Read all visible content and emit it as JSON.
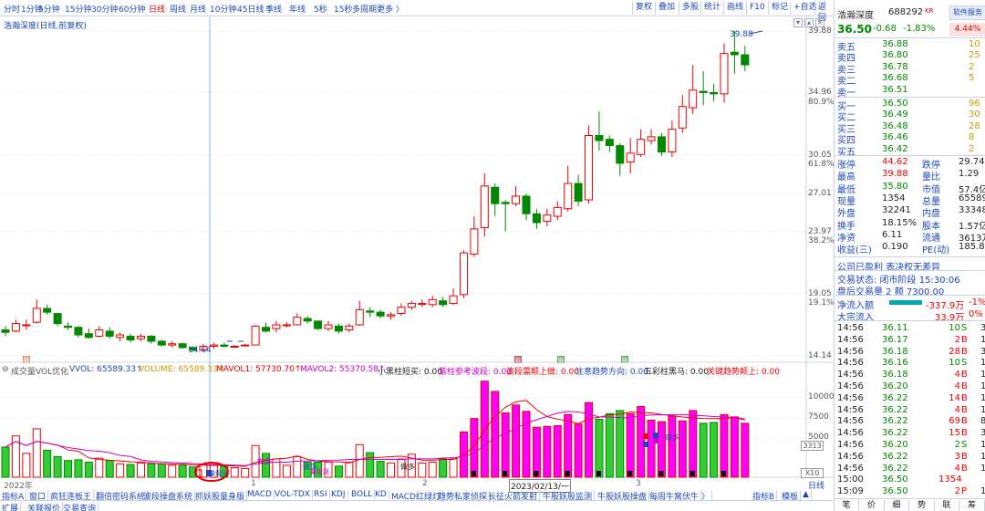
{
  "toolbar": {
    "periods": [
      "分时",
      "1分钟",
      "5分钟",
      "15分钟",
      "30分钟",
      "60分钟",
      "日线",
      "周线",
      "月线",
      "10分钟",
      "45日线",
      "季线",
      "年线",
      "5秒",
      "15秒",
      "多周期",
      "更多 〉"
    ],
    "active": "日线",
    "right": [
      "复权",
      "叠加",
      "多股",
      "统计",
      "画线",
      "F10",
      "标记",
      "+自选",
      "返回"
    ]
  },
  "chart_title": "浩瀚深度(日线,前复权)",
  "price_axis": [
    "39.88",
    "34.96",
    "30.05",
    "27.01",
    "23.97",
    "19.05",
    "14.14"
  ],
  "pct_axis": [
    "80.9%",
    "61.8%",
    "38.2%",
    "19.1%"
  ],
  "price_marks": {
    "high": "39.88",
    "low": "14.64"
  },
  "markers": [
    "融",
    "融",
    "融",
    "融"
  ],
  "candles": [
    {
      "o": 16.2,
      "c": 16.0,
      "h": 16.5,
      "l": 15.7
    },
    {
      "o": 16.1,
      "c": 16.7,
      "h": 17.0,
      "l": 16.0
    },
    {
      "o": 16.6,
      "c": 16.6,
      "h": 17.0,
      "l": 16.2
    },
    {
      "o": 16.8,
      "c": 17.9,
      "h": 18.6,
      "l": 16.7
    },
    {
      "o": 17.9,
      "c": 17.6,
      "h": 18.2,
      "l": 17.4
    },
    {
      "o": 17.5,
      "c": 16.7,
      "h": 17.5,
      "l": 16.5
    },
    {
      "o": 16.5,
      "c": 16.4,
      "h": 16.8,
      "l": 16.2
    },
    {
      "o": 16.4,
      "c": 15.8,
      "h": 16.5,
      "l": 15.6
    },
    {
      "o": 15.9,
      "c": 15.6,
      "h": 16.3,
      "l": 15.5
    },
    {
      "o": 15.7,
      "c": 16.2,
      "h": 16.5,
      "l": 15.6
    },
    {
      "o": 16.1,
      "c": 15.7,
      "h": 16.4,
      "l": 15.5
    },
    {
      "o": 15.6,
      "c": 15.8,
      "h": 16.0,
      "l": 15.3
    },
    {
      "o": 15.7,
      "c": 15.4,
      "h": 15.9,
      "l": 15.2
    },
    {
      "o": 15.5,
      "c": 15.7,
      "h": 15.9,
      "l": 15.3
    },
    {
      "o": 15.7,
      "c": 15.3,
      "h": 15.8,
      "l": 15.1
    },
    {
      "o": 15.3,
      "c": 15.0,
      "h": 15.4,
      "l": 14.9
    },
    {
      "o": 15.0,
      "c": 15.1,
      "h": 15.3,
      "l": 14.8
    },
    {
      "o": 15.1,
      "c": 14.8,
      "h": 15.2,
      "l": 14.7
    },
    {
      "o": 14.8,
      "c": 14.6,
      "h": 14.9,
      "l": 14.5
    },
    {
      "o": 14.6,
      "c": 14.9,
      "h": 15.1,
      "l": 14.5
    },
    {
      "o": 14.9,
      "c": 15.0,
      "h": 15.2,
      "l": 14.7
    },
    {
      "o": 15.0,
      "c": 14.9,
      "h": 15.2,
      "l": 14.8
    },
    {
      "o": 14.9,
      "c": 14.9,
      "h": 15.0,
      "l": 14.8
    },
    {
      "o": 15.0,
      "c": 15.0,
      "h": 15.1,
      "l": 14.9
    },
    {
      "o": 15.0,
      "c": 16.5,
      "h": 16.6,
      "l": 15.0
    },
    {
      "o": 16.4,
      "c": 16.1,
      "h": 16.8,
      "l": 16.0
    },
    {
      "o": 16.3,
      "c": 16.6,
      "h": 16.9,
      "l": 16.0
    },
    {
      "o": 16.6,
      "c": 16.6,
      "h": 16.8,
      "l": 16.4
    },
    {
      "o": 16.6,
      "c": 17.2,
      "h": 17.5,
      "l": 16.6
    },
    {
      "o": 17.1,
      "c": 16.9,
      "h": 17.3,
      "l": 16.7
    },
    {
      "o": 16.9,
      "c": 16.3,
      "h": 16.9,
      "l": 16.2
    },
    {
      "o": 16.3,
      "c": 16.6,
      "h": 16.9,
      "l": 16.1
    },
    {
      "o": 16.5,
      "c": 16.1,
      "h": 16.7,
      "l": 15.9
    },
    {
      "o": 16.2,
      "c": 16.5,
      "h": 16.7,
      "l": 16.0
    },
    {
      "o": 16.6,
      "c": 17.8,
      "h": 18.5,
      "l": 16.5
    },
    {
      "o": 17.7,
      "c": 17.6,
      "h": 18.0,
      "l": 17.2
    },
    {
      "o": 17.6,
      "c": 17.3,
      "h": 17.8,
      "l": 17.1
    },
    {
      "o": 17.3,
      "c": 17.4,
      "h": 17.6,
      "l": 17.0
    },
    {
      "o": 17.5,
      "c": 18.0,
      "h": 18.3,
      "l": 17.3
    },
    {
      "o": 18.0,
      "c": 18.3,
      "h": 18.5,
      "l": 17.8
    },
    {
      "o": 18.3,
      "c": 18.3,
      "h": 18.6,
      "l": 18.0
    },
    {
      "o": 18.2,
      "c": 18.6,
      "h": 18.9,
      "l": 18.0
    },
    {
      "o": 18.5,
      "c": 18.2,
      "h": 18.8,
      "l": 18.0
    },
    {
      "o": 18.3,
      "c": 18.9,
      "h": 19.5,
      "l": 18.2
    },
    {
      "o": 19.0,
      "c": 22.3,
      "h": 22.5,
      "l": 18.7
    },
    {
      "o": 22.2,
      "c": 24.2,
      "h": 25.2,
      "l": 22.0
    },
    {
      "o": 24.3,
      "c": 27.6,
      "h": 28.6,
      "l": 23.6
    },
    {
      "o": 27.5,
      "c": 26.2,
      "h": 27.8,
      "l": 25.2
    },
    {
      "o": 26.3,
      "c": 26.2,
      "h": 26.5,
      "l": 24.0
    },
    {
      "o": 26.2,
      "c": 26.8,
      "h": 27.6,
      "l": 26.0
    },
    {
      "o": 26.8,
      "c": 25.4,
      "h": 27.0,
      "l": 24.9
    },
    {
      "o": 25.4,
      "c": 24.7,
      "h": 25.8,
      "l": 24.2
    },
    {
      "o": 24.8,
      "c": 25.3,
      "h": 25.8,
      "l": 24.4
    },
    {
      "o": 25.2,
      "c": 25.9,
      "h": 26.4,
      "l": 24.9
    },
    {
      "o": 25.8,
      "c": 27.8,
      "h": 29.2,
      "l": 25.6
    },
    {
      "o": 27.8,
      "c": 26.4,
      "h": 28.5,
      "l": 26.0
    },
    {
      "o": 26.5,
      "c": 31.6,
      "h": 32.4,
      "l": 26.2
    },
    {
      "o": 31.6,
      "c": 31.2,
      "h": 33.5,
      "l": 30.4
    },
    {
      "o": 31.3,
      "c": 30.8,
      "h": 31.6,
      "l": 30.3
    },
    {
      "o": 30.8,
      "c": 29.4,
      "h": 31.0,
      "l": 28.4
    },
    {
      "o": 29.5,
      "c": 30.2,
      "h": 31.4,
      "l": 28.6
    },
    {
      "o": 30.1,
      "c": 31.3,
      "h": 32.1,
      "l": 29.9
    },
    {
      "o": 31.2,
      "c": 31.5,
      "h": 32.1,
      "l": 30.9
    },
    {
      "o": 31.5,
      "c": 30.3,
      "h": 31.8,
      "l": 30.0
    },
    {
      "o": 30.3,
      "c": 32.1,
      "h": 32.8,
      "l": 29.9
    },
    {
      "o": 32.2,
      "c": 33.9,
      "h": 34.8,
      "l": 31.8
    },
    {
      "o": 33.8,
      "c": 35.2,
      "h": 37.2,
      "l": 33.3
    },
    {
      "o": 35.1,
      "c": 35.0,
      "h": 36.7,
      "l": 34.0
    },
    {
      "o": 35.0,
      "c": 34.9,
      "h": 35.7,
      "l": 34.3
    },
    {
      "o": 34.9,
      "c": 38.1,
      "h": 38.9,
      "l": 34.2
    },
    {
      "o": 38.2,
      "c": 38.0,
      "h": 39.9,
      "l": 36.5
    },
    {
      "o": 38.0,
      "c": 37.2,
      "h": 38.7,
      "l": 36.7
    }
  ],
  "indicator": {
    "name": "成交量VOL优化",
    "vvol": "VVOL: 65589.33↑",
    "volume": "VOLUME: 65589.33↑",
    "mavol1": "MAVOL1: 57730.70↑",
    "mavol2": "MAVOL2: 55370.58↑",
    "t1": "小黑柱短买: 0.00",
    "t2": "紫柱参考波段: 0.00",
    "t3": "波段需颠上做: 0.00",
    "t4": "注意趋势方向: 0.00",
    "t5": "五彩柱黑马: 0.00",
    "t6": "关键趋势颠上: 0.00"
  },
  "vol_axis": [
    "10000",
    "7500",
    "5000",
    "3313"
  ],
  "vol_box": "X10",
  "vol_labels": [
    "做多",
    "做多",
    "做多",
    "做多"
  ],
  "vol_annots": [
    "量级涨",
    "量级涨",
    "资金涨",
    "资金涨"
  ],
  "time_labels": [
    "2022年",
    "1",
    "2",
    "2023/02/13/一",
    "3"
  ],
  "daily": "日线",
  "tabs1": [
    "指标A",
    "窗口",
    "疯狂连板王",
    "翻倍密码系统",
    "波段操盘系统",
    "抓妖股量身版",
    "MACD",
    "VOL-TDX",
    "RSI",
    "KDJ",
    "BOLL",
    "KD",
    "MACD红绿灯",
    "趋势私家侦探",
    "长征火箭发射",
    "牛股妖股监测",
    "牛股妖股操盘",
    "每周牛窝伏牛",
    "〉"
  ],
  "tabs1r": [
    "指标B",
    "模板",
    "▲"
  ],
  "tabs2": [
    "扩展",
    "关联报价",
    "交易查询"
  ],
  "panel": {
    "name": "浩瀚深度",
    "code": "688292",
    "kr": "KR",
    "btn": "软件服务",
    "price": "36.50",
    "chg": "-0.68",
    "pct": "-1.83%",
    "pct2": "4.44%",
    "sells": [
      [
        "卖五",
        "36.88",
        "10"
      ],
      [
        "卖四",
        "36.80",
        "25"
      ],
      [
        "卖三",
        "36.78",
        "2"
      ],
      [
        "卖二",
        "36.68",
        "5"
      ],
      [
        "卖一",
        "36.51",
        ""
      ]
    ],
    "buys": [
      [
        "买一",
        "36.50",
        "96"
      ],
      [
        "买二",
        "36.49",
        "30"
      ],
      [
        "买三",
        "36.48",
        "28"
      ],
      [
        "买四",
        "36.46",
        "8"
      ],
      [
        "买五",
        "36.42",
        "2"
      ]
    ],
    "stats": [
      [
        "涨停",
        "44.62",
        "跌停",
        "29.74"
      ],
      [
        "最高",
        "39.88",
        "量比",
        "1.29"
      ],
      [
        "最低",
        "35.80",
        "市值",
        "57.4亿"
      ],
      [
        "现量",
        "1354",
        "总量",
        "65589"
      ],
      [
        "外盘",
        "32241",
        "内盘",
        "33348"
      ],
      [
        "换手",
        "18.15%",
        "股本",
        "1.57亿"
      ],
      [
        "净资",
        "6.11",
        "流通",
        "3613万"
      ],
      [
        "收益(三)",
        "0.190",
        "PE(动)",
        "185.8"
      ]
    ],
    "notice": "公司已盈利 表决权无差异",
    "status": "交易状态: 闭市阶段 15:30:06",
    "after": "盘后交易量 2 额 7300.00",
    "flow": [
      [
        "净流入额",
        "-337.9万",
        "-1%"
      ],
      [
        "大宗流入",
        "33.9万",
        "0%"
      ]
    ],
    "ticks": [
      [
        "14:56",
        "36.11",
        "10",
        "S",
        "3"
      ],
      [
        "14:56",
        "36.17",
        "2",
        "B",
        "1"
      ],
      [
        "14:56",
        "36.18",
        "28",
        "B",
        "3"
      ],
      [
        "14:56",
        "36.16",
        "10",
        "S",
        "1"
      ],
      [
        "14:56",
        "36.18",
        "4",
        "B",
        "1"
      ],
      [
        "14:56",
        "36.20",
        "4",
        "B",
        "1"
      ],
      [
        "14:56",
        "36.22",
        "14",
        "B",
        "1"
      ],
      [
        "14:56",
        "36.22",
        "4",
        "B",
        "1"
      ],
      [
        "14:56",
        "36.22",
        "69",
        "B",
        "8"
      ],
      [
        "14:56",
        "36.22",
        "15",
        "B",
        "3"
      ],
      [
        "14:56",
        "36.20",
        "2",
        "S",
        "1"
      ],
      [
        "14:56",
        "36.22",
        "3",
        "B",
        "1"
      ],
      [
        "14:56",
        "36.22",
        "4",
        "B",
        "1"
      ],
      [
        "15:00",
        "36.50",
        "1354",
        "",
        ""
      ],
      [
        "15:09",
        "36.50",
        "2",
        "P",
        "1"
      ]
    ],
    "bottom": [
      "笔",
      "价",
      "细",
      "势",
      "联",
      "筹"
    ]
  }
}
